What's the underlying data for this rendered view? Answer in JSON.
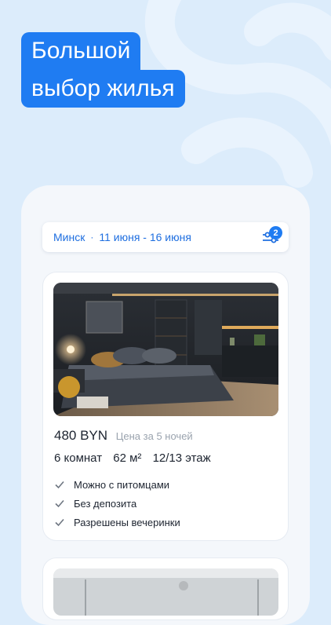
{
  "headline": {
    "line1": "Большой",
    "line2": "выбор жилья"
  },
  "search": {
    "city": "Минск",
    "separator": "·",
    "dates": "11 июня - 16 июня",
    "filter_badge": "2"
  },
  "listing": {
    "price": "480 BYN",
    "price_note": "Цена за 5 ночей",
    "rooms": "6 комнат",
    "area": "62 м²",
    "floor": "12/13 этаж",
    "features": [
      "Можно с питомцами",
      "Без депозита",
      "Разрешены вечеринки"
    ]
  },
  "colors": {
    "accent": "#1f7cf2",
    "background": "#dcecfb"
  },
  "icons": {
    "filter": "sliders-icon",
    "feature": "check-icon"
  }
}
